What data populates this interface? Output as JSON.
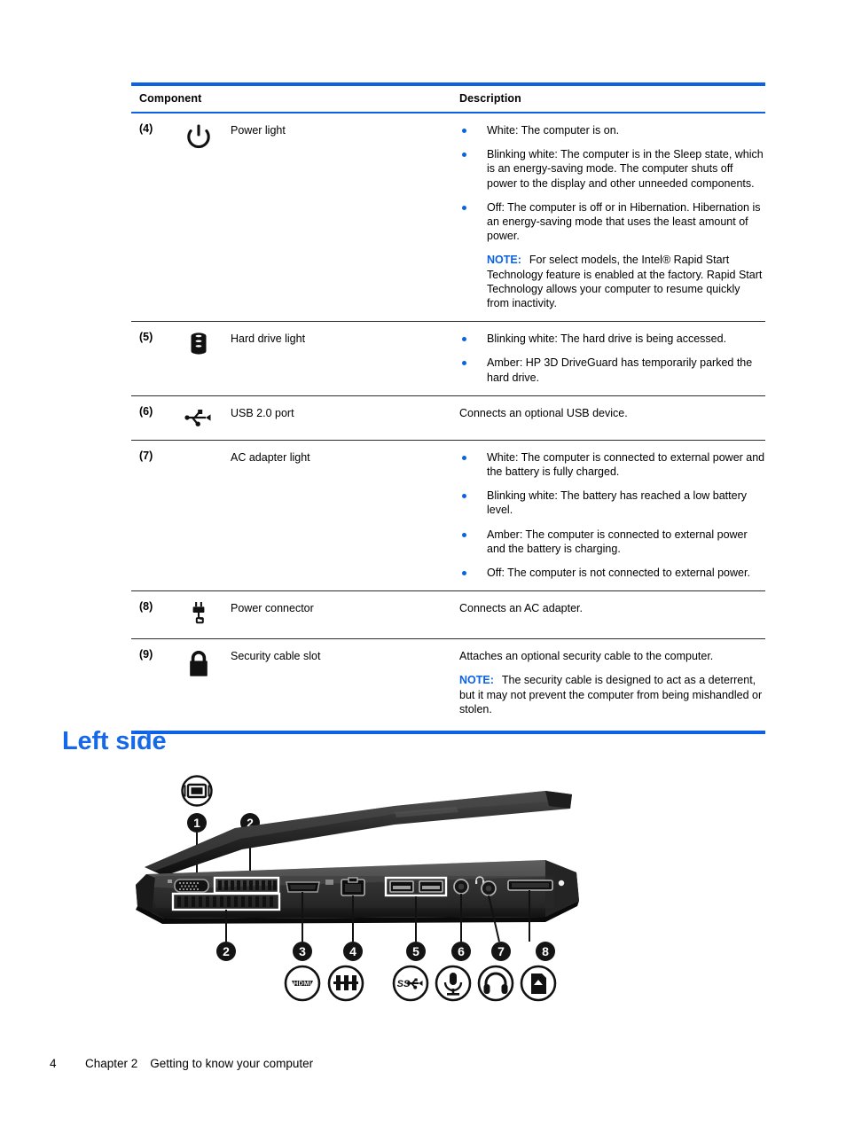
{
  "table": {
    "headers": {
      "component": "Component",
      "description": "Description"
    },
    "rows": [
      {
        "num": "(4)",
        "icon": "power-icon",
        "name": "Power light",
        "bullets": [
          "White: The computer is on.",
          "Blinking white: The computer is in the Sleep state, which is an energy-saving mode. The computer shuts off power to the display and other unneeded components.",
          "Off: The computer is off or in Hibernation. Hibernation is an energy-saving mode that uses the least amount of power."
        ],
        "note_label": "NOTE:",
        "note_text": "For select models, the Intel® Rapid Start Technology feature is enabled at the factory. Rapid Start Technology allows your computer to resume quickly from inactivity."
      },
      {
        "num": "(5)",
        "icon": "hard-drive-icon",
        "name": "Hard drive light",
        "bullets": [
          "Blinking white: The hard drive is being accessed.",
          "Amber: HP 3D DriveGuard has temporarily parked the hard drive."
        ]
      },
      {
        "num": "(6)",
        "icon": "usb-icon",
        "name": "USB 2.0 port",
        "description": "Connects an optional USB device."
      },
      {
        "num": "(7)",
        "icon": "none",
        "name": "AC adapter light",
        "bullets": [
          "White: The computer is connected to external power and the battery is fully charged.",
          "Blinking white: The battery has reached a low battery level.",
          "Amber: The computer is connected to external power and the battery is charging.",
          "Off: The computer is not connected to external power."
        ]
      },
      {
        "num": "(8)",
        "icon": "power-connector-icon",
        "name": "Power connector",
        "description": "Connects an AC adapter."
      },
      {
        "num": "(9)",
        "icon": "lock-icon",
        "name": "Security cable slot",
        "description": "Attaches an optional security cable to the computer.",
        "note_label": "NOTE:",
        "note_text": "The security cable is designed to act as a deterrent, but it may not prevent the computer from being mishandled or stolen."
      }
    ]
  },
  "section": {
    "heading": "Left side"
  },
  "figure": {
    "name": "left-side-laptop-diagram",
    "callouts_top": [
      "1",
      "2"
    ],
    "callouts_bottom": [
      "2",
      "3",
      "4",
      "5",
      "6",
      "7",
      "8"
    ],
    "top_badge_icon": "external-monitor-icon",
    "port_icons": [
      "hdmi-icon",
      "rj45-network-icon",
      "usb-superspeed-icon",
      "microphone-icon",
      "headphone-icon",
      "memory-card-icon"
    ],
    "hdmi_label": "HDMI",
    "ss_label": "SS"
  },
  "footer": {
    "page_number": "4",
    "chapter": "Chapter 2",
    "title": "Getting to know your computer"
  },
  "colors": {
    "accent_blue": "#0b62e4",
    "heading_blue": "#1569e8",
    "rule_dark": "#2b2b2b"
  }
}
